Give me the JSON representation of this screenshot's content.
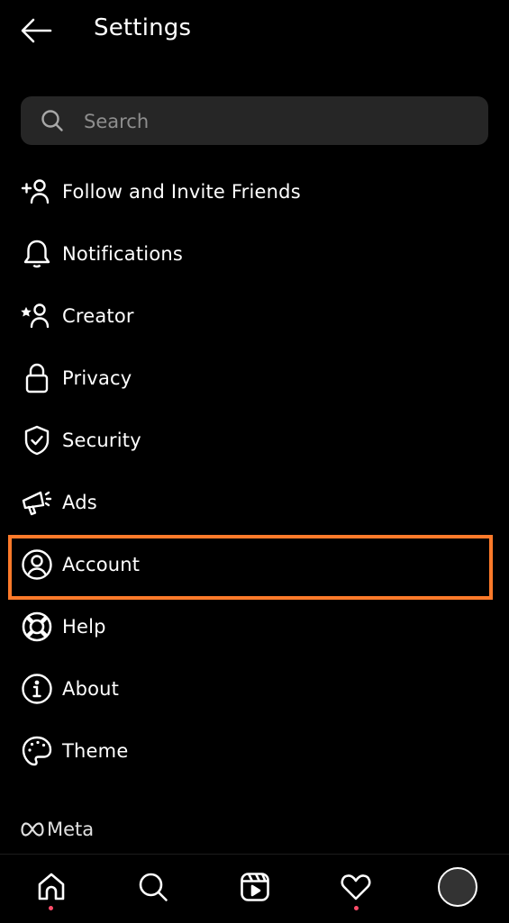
{
  "header": {
    "back_icon": "arrow-left-icon",
    "title": "Settings"
  },
  "search": {
    "icon": "search-icon",
    "placeholder": "Search",
    "value": ""
  },
  "menu": {
    "items": [
      {
        "label": "Follow and Invite Friends",
        "icon": "add-person-icon"
      },
      {
        "label": "Notifications",
        "icon": "bell-icon"
      },
      {
        "label": "Creator",
        "icon": "star-person-icon"
      },
      {
        "label": "Privacy",
        "icon": "lock-icon"
      },
      {
        "label": "Security",
        "icon": "shield-check-icon"
      },
      {
        "label": "Ads",
        "icon": "megaphone-icon"
      },
      {
        "label": "Account",
        "icon": "account-circle-icon",
        "highlighted": true
      },
      {
        "label": "Help",
        "icon": "lifebuoy-icon"
      },
      {
        "label": "About",
        "icon": "info-icon"
      },
      {
        "label": "Theme",
        "icon": "palette-icon"
      }
    ]
  },
  "highlight_color": "#ff7a2a",
  "footer": {
    "brand": "Meta",
    "brand_icon": "meta-logo-icon"
  },
  "bottom_nav": {
    "items": [
      {
        "name": "home",
        "icon": "home-icon",
        "notification_dot": true
      },
      {
        "name": "search",
        "icon": "search-icon",
        "notification_dot": false
      },
      {
        "name": "reels",
        "icon": "reels-icon",
        "notification_dot": false
      },
      {
        "name": "activity",
        "icon": "heart-icon",
        "notification_dot": true
      },
      {
        "name": "profile",
        "icon": "avatar",
        "notification_dot": false
      }
    ],
    "dot_color": "#ff4d6a"
  }
}
